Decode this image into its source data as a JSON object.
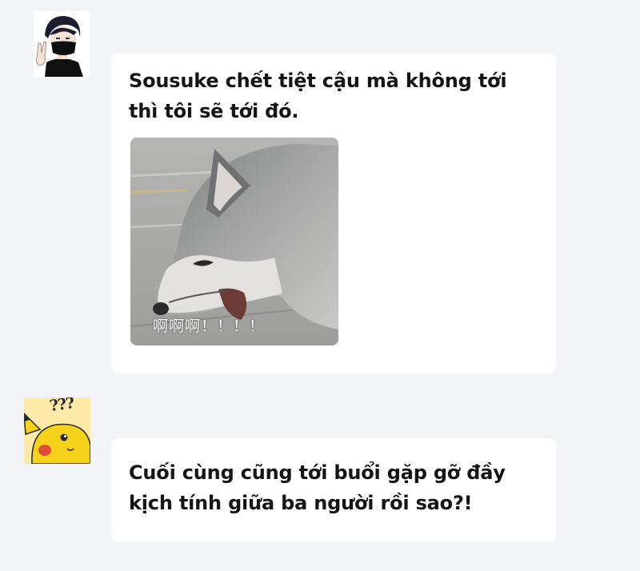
{
  "messages": [
    {
      "avatar": "avatar-masked-guy-icon",
      "text": "Sousuke chết tiệt cậu mà không tới thì tôi sẽ tới đó.",
      "sticker_caption": "啊啊啊！！！！"
    },
    {
      "avatar": "avatar-pikachu-confused-icon",
      "avatar_marks": "???",
      "text": "Cuối cùng cũng tới buổi gặp gỡ đầy kịch tính giữa ba người rồi sao?!"
    }
  ],
  "colors": {
    "background": "#f3f4f8",
    "bubble": "#ffffff",
    "text": "#151515"
  }
}
